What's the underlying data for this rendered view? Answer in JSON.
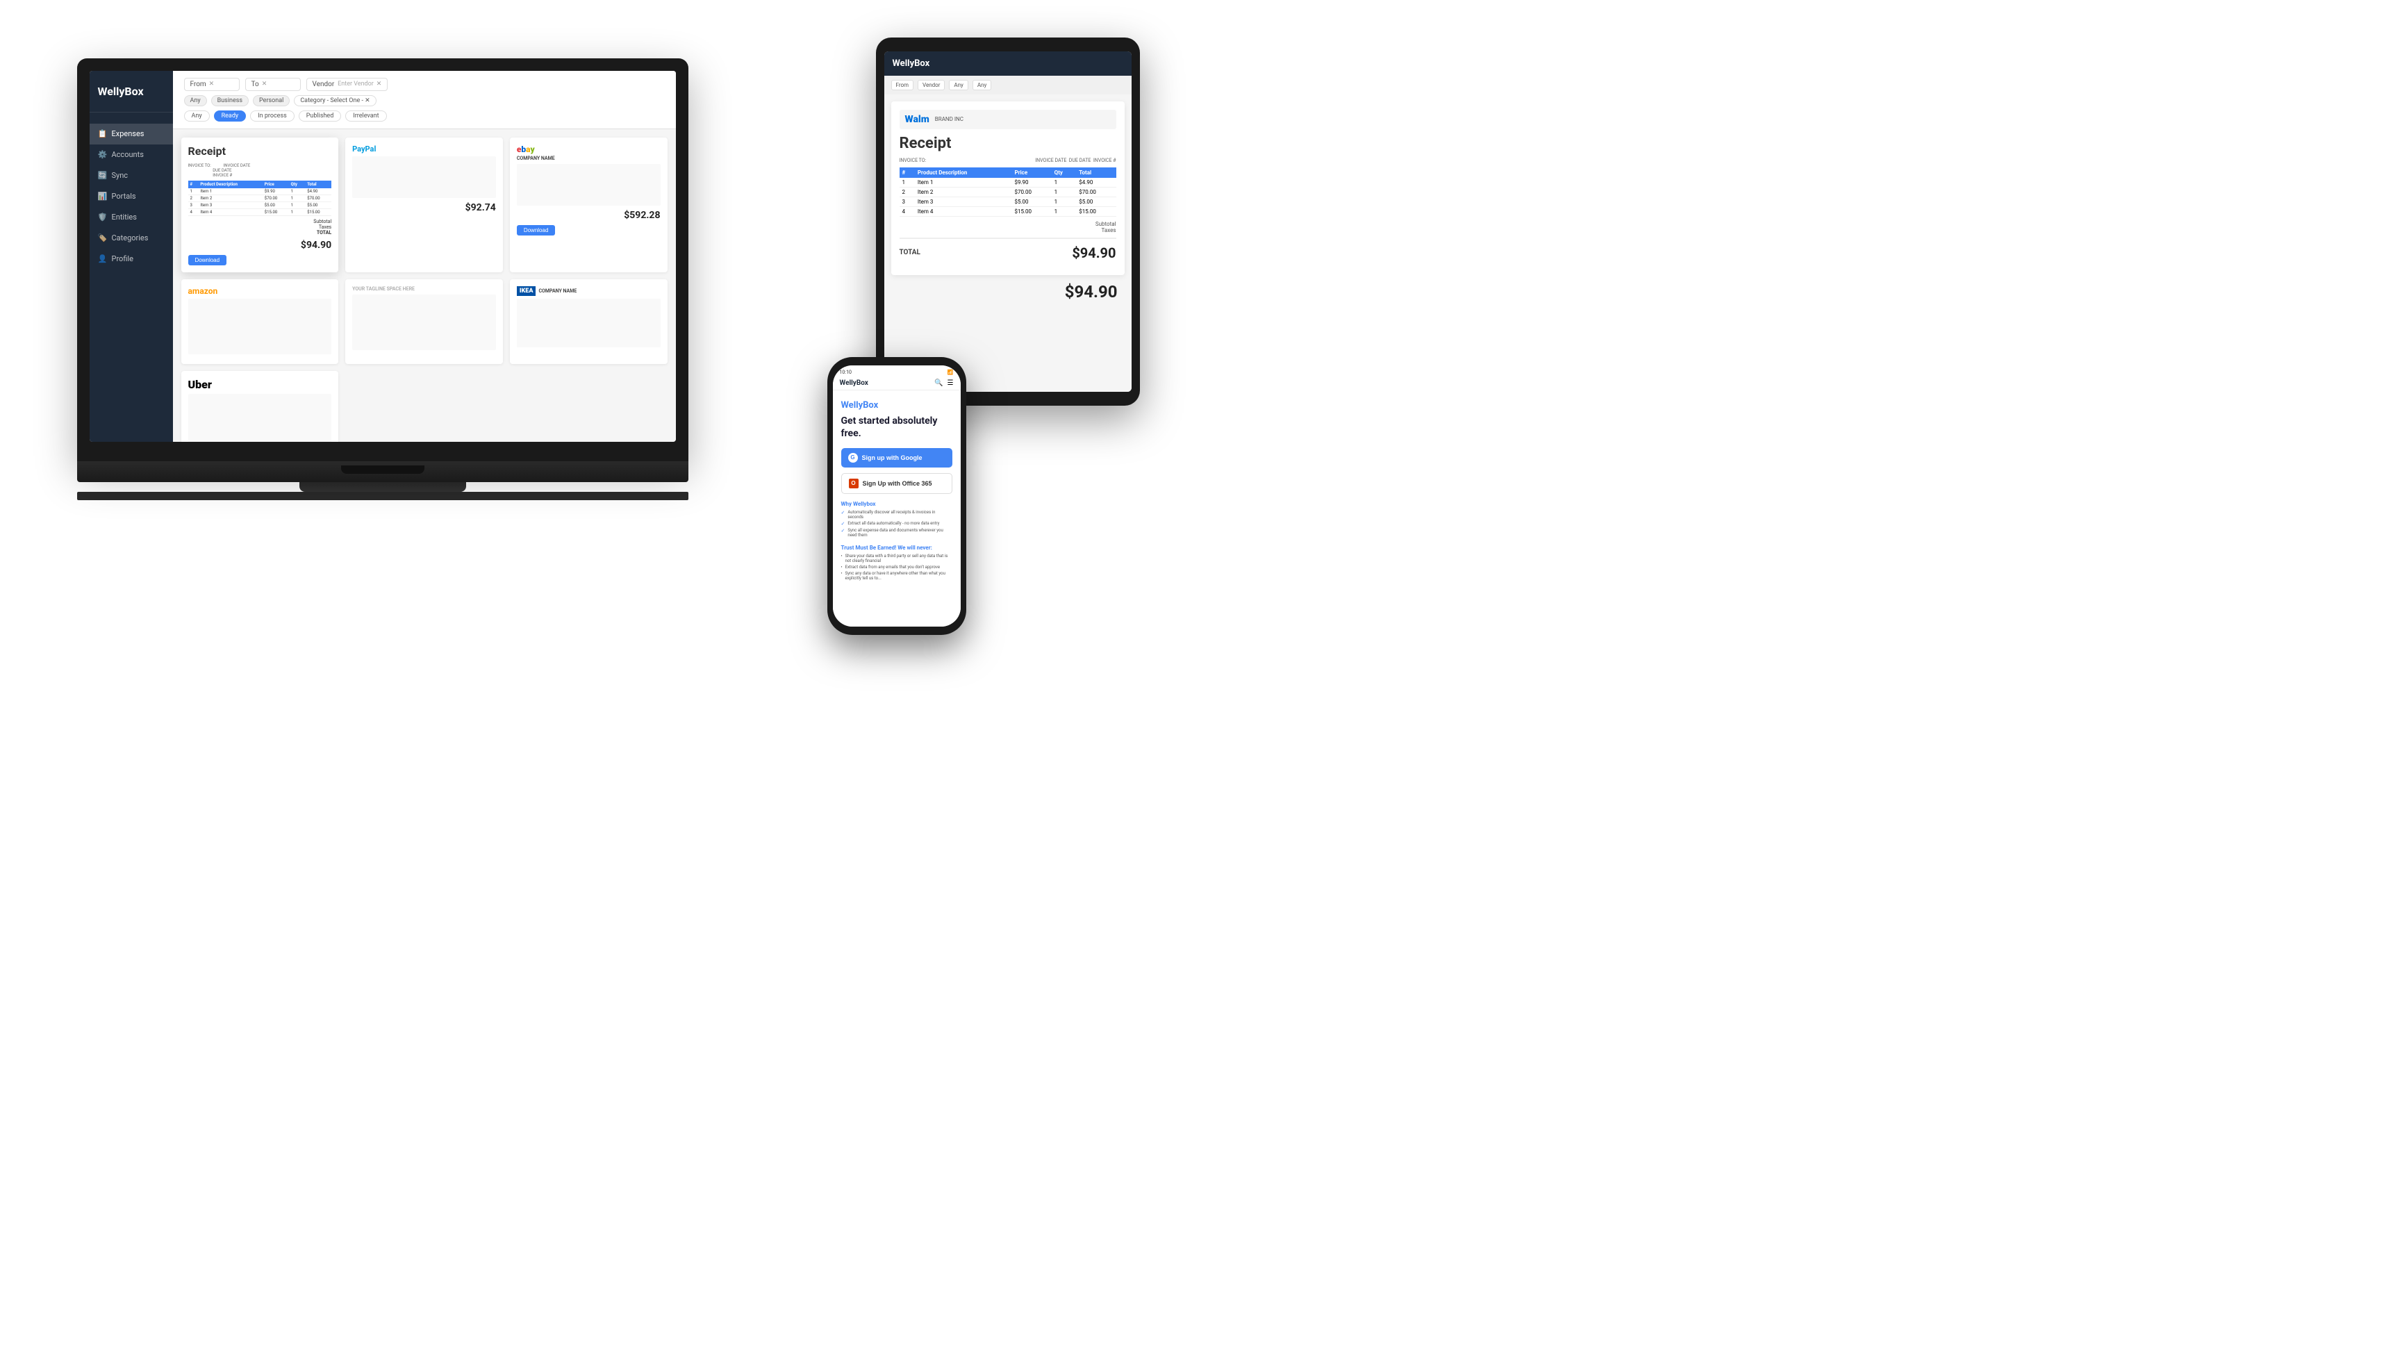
{
  "laptop": {
    "brand": "WellyBox",
    "nav": {
      "items": [
        {
          "label": "Expenses",
          "icon": "📋",
          "active": true
        },
        {
          "label": "Accounts",
          "icon": "⚙️",
          "active": false
        },
        {
          "label": "Sync",
          "icon": "🔄",
          "active": false
        },
        {
          "label": "Portals",
          "icon": "📊",
          "active": false
        },
        {
          "label": "Entities",
          "icon": "🛡️",
          "active": false
        },
        {
          "label": "Categories",
          "icon": "🏷️",
          "active": false
        },
        {
          "label": "Profile",
          "icon": "👤",
          "active": false
        }
      ]
    },
    "filters": {
      "from_label": "From",
      "to_label": "To",
      "vendor_placeholder": "Enter Vendor",
      "category_placeholder": "Select One",
      "tags": [
        "Any",
        "Business",
        "Personal"
      ],
      "status_tags": [
        "Any",
        "Ready",
        "In process",
        "Published",
        "Irrelevant"
      ]
    },
    "receipts": [
      {
        "title": "Receipt",
        "amount": "$94.90",
        "items": [
          {
            "num": 1,
            "desc": "Item 1",
            "price": "$9.90",
            "qty": 1,
            "total": "$4.90"
          },
          {
            "num": 2,
            "desc": "Item 2",
            "price": "$70.00",
            "qty": 1,
            "total": "$70.00"
          },
          {
            "num": 3,
            "desc": "Item 3",
            "price": "$5.00",
            "qty": 1,
            "total": "$5.00"
          },
          {
            "num": 4,
            "desc": "Item 4",
            "price": "$15.00",
            "qty": 1,
            "total": "$15.00"
          }
        ],
        "subtotal": "Subtotal",
        "taxes": "Taxes",
        "total_label": "TOTAL",
        "download": "Download"
      },
      {
        "brand": "PayPal",
        "amount": "$92.74"
      },
      {
        "brand": "eBay",
        "company": "COMPANY NAME",
        "amount": "$592.28"
      },
      {
        "brand": "amazon",
        "amount": ""
      },
      {
        "brand": "TAGLINE SPACE HERE",
        "amount": ""
      },
      {
        "brand": "IKEA",
        "company": "COMPANY NAME",
        "amount": ""
      },
      {
        "brand": "Uber",
        "amount": ""
      }
    ]
  },
  "tablet": {
    "brand": "WellyBox",
    "filters": {
      "from_label": "From",
      "vendor_label": "Vendor",
      "any_label": "Any",
      "any2_label": "Any"
    },
    "receipt": {
      "title": "Receipt",
      "invoice_to_label": "INVOICE TO:",
      "invoice_date_label": "INVOICE DATE",
      "due_date_label": "DUE DATE",
      "invoice_num_label": "INVOICE #",
      "walmart_brand": "Walm",
      "columns": [
        "#",
        "Product Description",
        "Price",
        "Qty",
        "Total"
      ],
      "items": [
        {
          "num": 1,
          "desc": "Item 1",
          "price": "$9.90",
          "qty": 1,
          "total": "$4.90"
        },
        {
          "num": 2,
          "desc": "Item 2",
          "price": "$70.00",
          "qty": 1,
          "total": "$70.00"
        },
        {
          "num": 3,
          "desc": "Item 3",
          "price": "$5.00",
          "qty": 1,
          "total": "$5.00"
        },
        {
          "num": 4,
          "desc": "Item 4",
          "price": "$15.00",
          "qty": 1,
          "total": "$15.00"
        }
      ],
      "subtotal_label": "Subtotal",
      "taxes_label": "Taxes",
      "total_label": "TOTAL",
      "total_value": "$94.90",
      "big_total": "$94.90"
    }
  },
  "phone": {
    "brand": "WellyBox",
    "status_time": "10:10",
    "headline": "Get started absolutely free.",
    "google_btn": "Sign up with Google",
    "office_btn": "Sign Up with Office 365",
    "why_title": "Why Wellybox",
    "features": [
      "Automatically discover all receipts & invoices in seconds",
      "Extract all data automatically - no more data entry",
      "Sync all expense data and documents wherever you need them"
    ],
    "trust_title": "Trust Must Be Earned! We will never:",
    "trust_items": [
      "Share your data with a third party or sell any data that is not clearly financial",
      "Extract data from any emails that you don't approve",
      "Sync any data or have it anywhere other than what you explicitly tell us to..."
    ]
  }
}
